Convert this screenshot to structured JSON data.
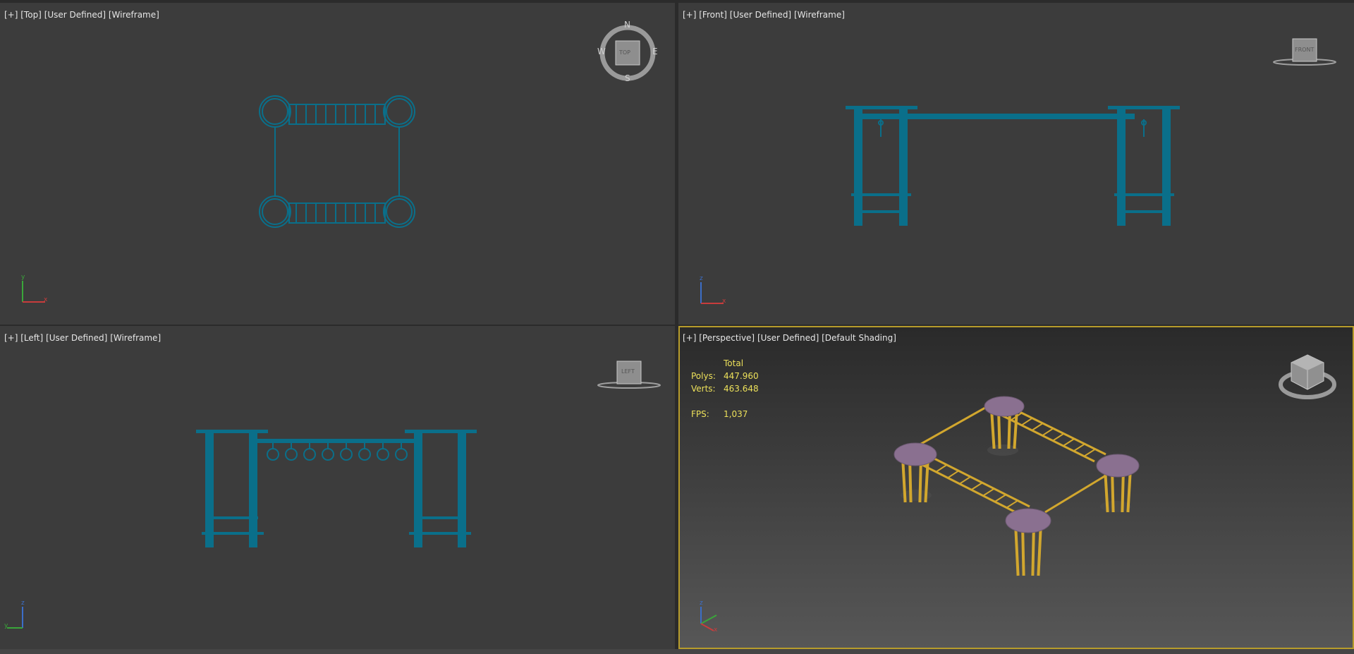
{
  "viewports": {
    "top": {
      "plus": "[+]",
      "view": "[Top]",
      "mode": "[User Defined]",
      "shading": "[Wireframe]",
      "compass": {
        "n": "N",
        "s": "S",
        "e": "E",
        "w": "W",
        "cube": "TOP"
      },
      "axes": {
        "a": "y",
        "b": "x"
      }
    },
    "front": {
      "plus": "[+]",
      "view": "[Front]",
      "mode": "[User Defined]",
      "shading": "[Wireframe]",
      "cube": "FRONT",
      "axes": {
        "a": "z",
        "b": "x"
      }
    },
    "left": {
      "plus": "[+]",
      "view": "[Left]",
      "mode": "[User Defined]",
      "shading": "[Wireframe]",
      "cube": "LEFT",
      "axes": {
        "a": "z",
        "b": "y"
      }
    },
    "persp": {
      "plus": "[+]",
      "view": "[Perspective]",
      "mode": "[User Defined]",
      "shading": "[Default Shading]",
      "stats": {
        "header": "Total",
        "polys_label": "Polys:",
        "polys_value": "447.960",
        "verts_label": "Verts:",
        "verts_value": "463.648",
        "fps_label": "FPS:",
        "fps_value": "1,037"
      },
      "axes": {
        "a": "z",
        "b": "x"
      }
    }
  },
  "colors": {
    "wire": "#0a6f8a",
    "active_border": "#b79c2b",
    "stats": "#ece05a",
    "yellow_frame": "#d2a72e",
    "platform": "#8a7090"
  }
}
